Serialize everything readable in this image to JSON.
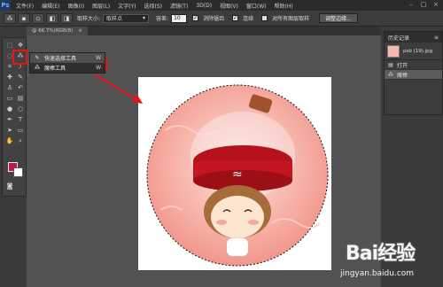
{
  "app": {
    "logo": "Ps"
  },
  "menu": [
    "文件(F)",
    "编辑(E)",
    "图像(I)",
    "图层(L)",
    "文字(Y)",
    "选择(S)",
    "滤镜(T)",
    "3D(D)",
    "视图(V)",
    "窗口(W)",
    "帮助(H)"
  ],
  "window_controls": [
    "–",
    "□",
    "×"
  ],
  "options": {
    "size_label": "取样大小:",
    "size_value": "取样点",
    "tolerance_label": "容差:",
    "tolerance_value": "10",
    "antialias_label": "消除锯齿",
    "contiguous_label": "连续",
    "sample_all_label": "对所有图层取样",
    "refine_label": "调整边缘..."
  },
  "document_tab": "@ 66.7%(RGB/8)",
  "flyout": {
    "items": [
      {
        "icon": "quick-selection-icon",
        "glyph": "✎",
        "label": "快速选择工具",
        "key": "W"
      },
      {
        "icon": "magic-wand-icon",
        "glyph": "⁂",
        "label": "魔棒工具",
        "key": "W"
      }
    ]
  },
  "colors": {
    "foreground": "#c5144a",
    "background": "#ffffff",
    "annotation": "#e11111"
  },
  "history": {
    "title": "历史记录",
    "snapshot": "psb (19).jpg",
    "rows": [
      {
        "icon": "document-icon",
        "label": "打开"
      },
      {
        "icon": "magic-wand-icon",
        "label": "魔棒"
      }
    ]
  },
  "watermark": {
    "logo": "Bai经验",
    "url": "jingyan.baidu.com"
  }
}
